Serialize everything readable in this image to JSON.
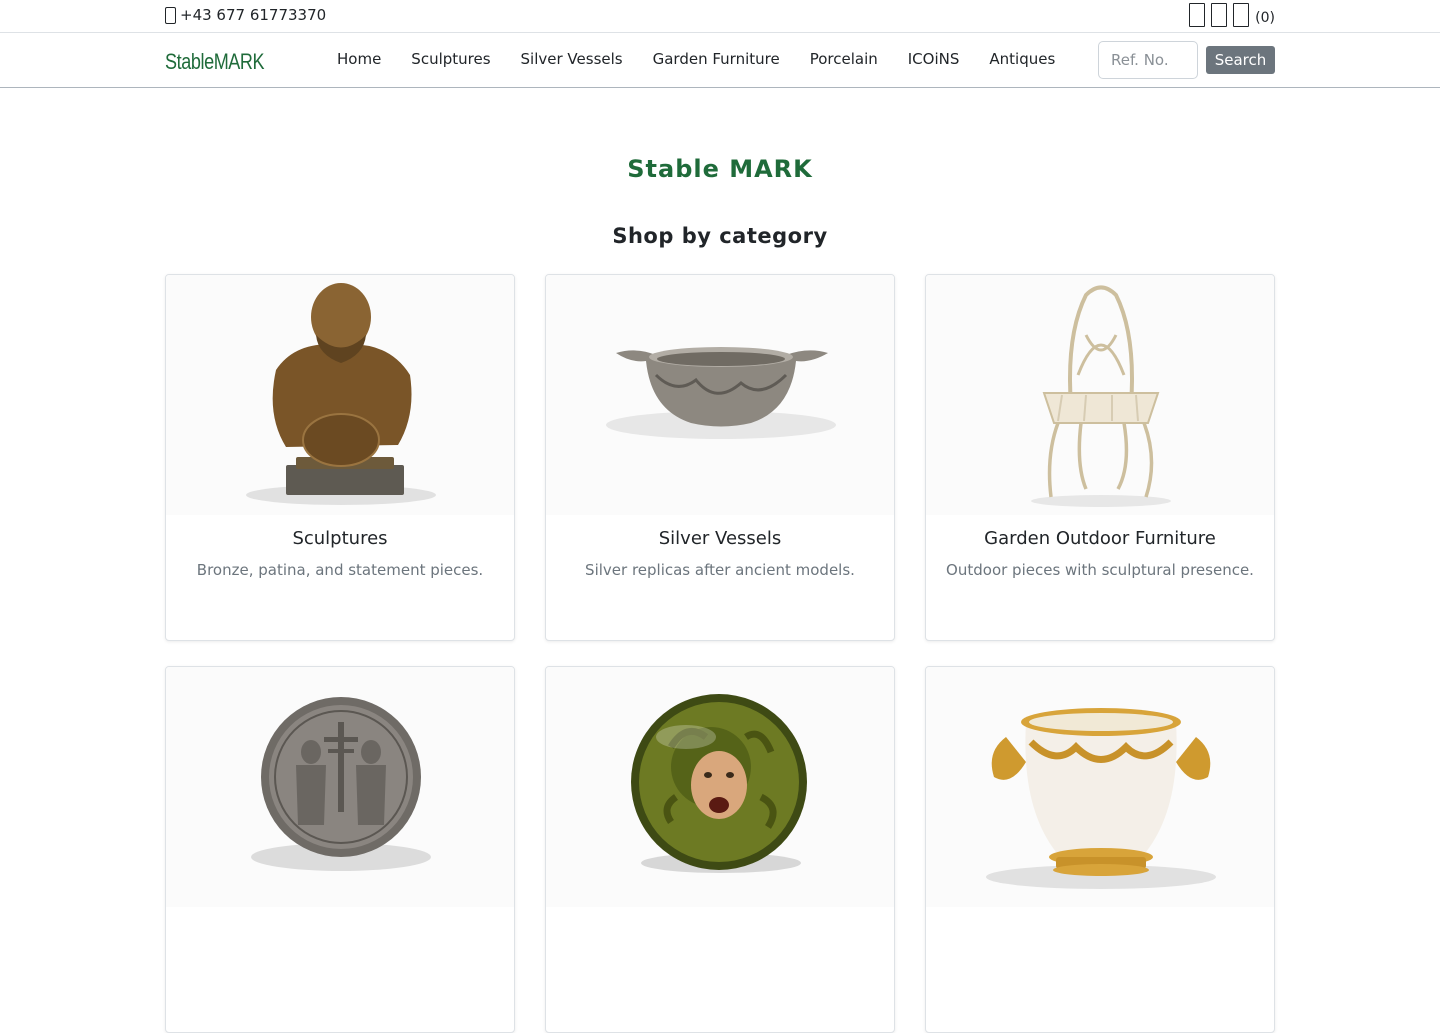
{
  "topbar": {
    "phone": "+43 677 61773370",
    "icons": [
      "user-icon",
      "heart-icon",
      "cart-icon"
    ],
    "cart_count": "(0)"
  },
  "navbar": {
    "brand": "StableMARK",
    "links": [
      "Home",
      "Sculptures",
      "Silver Vessels",
      "Garden Furniture",
      "Porcelain",
      "ICOiNS",
      "Antiques"
    ],
    "search_placeholder": "Ref. No.",
    "search_button": "Search"
  },
  "hero": {
    "title": "Stable MARK",
    "subtitle": "Shop by category"
  },
  "categories": [
    {
      "title": "Sculptures",
      "desc": "Bronze, patina, and statement pieces.",
      "image": "bronze-bust"
    },
    {
      "title": "Silver Vessels",
      "desc": "Silver replicas after ancient models.",
      "image": "silver-bowl"
    },
    {
      "title": "Garden Outdoor Furniture",
      "desc": "Outdoor pieces with sculptural presence.",
      "image": "garden-chair"
    },
    {
      "title": "",
      "desc": "",
      "image": "silver-coin"
    },
    {
      "title": "",
      "desc": "",
      "image": "medusa-plate"
    },
    {
      "title": "",
      "desc": "",
      "image": "porcelain-vase"
    }
  ],
  "colors": {
    "brand_green": "#1f6b3a",
    "button_gray": "#6c757d",
    "muted_text": "#6c757d"
  }
}
